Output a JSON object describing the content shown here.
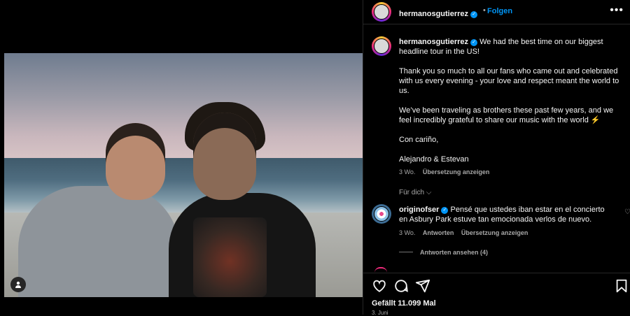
{
  "post": {
    "username": "hermanosgutierrez",
    "follow_label": "Folgen",
    "caption_paragraphs": [
      "We had the best time on our biggest headline tour in the US!",
      "Thank you so much to all our fans who came out and celebrated with us every evening - your love and respect meant the world to us.",
      "We’ve been traveling as brothers these past few years, and we feel incredibly grateful to share our music with the world ⚡",
      "Con cariño,",
      "Alejandro & Estevan"
    ],
    "caption_time": "3 Wo.",
    "translate_label": "Übersetzung anzeigen",
    "for_you_label": "Für dich",
    "likes": "Gefällt 11.099 Mal",
    "date": "3. Juni"
  },
  "comment": {
    "username": "originofser",
    "text": "Pensé que ustedes iban estar en el concierto en Asbury Park estuve tan emocionada verlos de nuevo.",
    "time": "3 Wo.",
    "reply_label": "Antworten",
    "translate_label": "Übersetzung anzeigen",
    "view_replies": "Antworten ansehen (4)"
  },
  "icons": {
    "more": "more-horizontal-icon",
    "like": "heart-icon",
    "comment": "comment-icon",
    "share": "share-icon",
    "save": "bookmark-icon",
    "tagged": "user-tag-icon",
    "verified": "verified-badge-icon"
  },
  "colors": {
    "accent": "#0095f6",
    "text": "#f5f5f5",
    "secondary": "#a8a8a8",
    "background": "#000000"
  }
}
